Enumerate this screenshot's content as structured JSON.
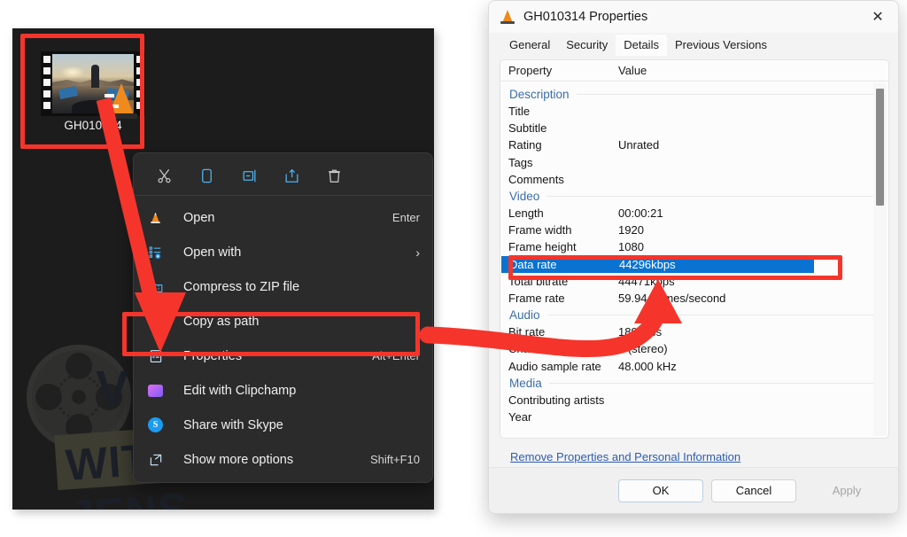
{
  "desktop": {
    "file": {
      "name": "GH010314",
      "icon": "video-file-thumbnail",
      "overlay_icon": "vlc-cone-icon"
    },
    "watermark": {
      "line1": "VIDEO",
      "line2": "WITH JENS",
      "logo": "film-reel-icon"
    },
    "background_color": "#1c1c1c"
  },
  "context_menu": {
    "toolbar": [
      {
        "name": "cut-icon",
        "label": "Cut"
      },
      {
        "name": "copy-icon",
        "label": "Copy"
      },
      {
        "name": "rename-icon",
        "label": "Rename"
      },
      {
        "name": "share-icon",
        "label": "Share"
      },
      {
        "name": "delete-icon",
        "label": "Delete"
      }
    ],
    "items": [
      {
        "label": "Open",
        "accel": "Enter",
        "icon": "vlc-cone-icon",
        "chevron": ""
      },
      {
        "label": "Open with",
        "accel": "",
        "icon": "open-with-icon",
        "chevron": "›"
      },
      {
        "label": "Compress to ZIP file",
        "accel": "",
        "icon": "zip-folder-icon",
        "chevron": ""
      },
      {
        "label": "Copy as path",
        "accel": "",
        "icon": "copy-as-path-icon",
        "chevron": ""
      },
      {
        "label": "Properties",
        "accel": "Alt+Enter",
        "icon": "properties-icon",
        "chevron": ""
      },
      {
        "label": "Edit with Clipchamp",
        "accel": "",
        "icon": "clipchamp-icon",
        "chevron": ""
      },
      {
        "label": "Share with Skype",
        "accel": "",
        "icon": "skype-icon",
        "chevron": ""
      },
      {
        "label": "Show more options",
        "accel": "Shift+F10",
        "icon": "show-more-options-icon",
        "chevron": ""
      }
    ]
  },
  "dialog": {
    "title": "GH010314 Properties",
    "title_icon": "vlc-cone-icon",
    "close_icon": "close-icon",
    "tabs": [
      {
        "label": "General",
        "active": false
      },
      {
        "label": "Security",
        "active": false
      },
      {
        "label": "Details",
        "active": true
      },
      {
        "label": "Previous Versions",
        "active": false
      }
    ],
    "columns": {
      "property": "Property",
      "value": "Value"
    },
    "groups": [
      {
        "name": "Description",
        "rows": [
          {
            "key": "Title",
            "value": ""
          },
          {
            "key": "Subtitle",
            "value": ""
          },
          {
            "key": "Rating",
            "value": "Unrated"
          },
          {
            "key": "Tags",
            "value": ""
          },
          {
            "key": "Comments",
            "value": ""
          }
        ]
      },
      {
        "name": "Video",
        "rows": [
          {
            "key": "Length",
            "value": "00:00:21"
          },
          {
            "key": "Frame width",
            "value": "1920"
          },
          {
            "key": "Frame height",
            "value": "1080"
          },
          {
            "key": "Data rate",
            "value": "44296kbps",
            "selected": true
          },
          {
            "key": "Total bitrate",
            "value": "44471kbps"
          },
          {
            "key": "Frame rate",
            "value": "59.94 frames/second"
          }
        ]
      },
      {
        "name": "Audio",
        "rows": [
          {
            "key": "Bit rate",
            "value": "189kbps"
          },
          {
            "key": "Channels",
            "value": "2 (stereo)"
          },
          {
            "key": "Audio sample rate",
            "value": "48.000 kHz"
          }
        ]
      },
      {
        "name": "Media",
        "rows": [
          {
            "key": "Contributing artists",
            "value": ""
          },
          {
            "key": "Year",
            "value": ""
          }
        ]
      }
    ],
    "remove_link": "Remove Properties and Personal Information",
    "buttons": {
      "ok": "OK",
      "cancel": "Cancel",
      "apply": "Apply"
    },
    "selection_color": "#0a72d0"
  },
  "annotations": {
    "highlight_color": "#f5352b",
    "boxes": [
      {
        "name": "file-icon-highlight"
      },
      {
        "name": "properties-menu-item-highlight"
      },
      {
        "name": "data-rate-row-highlight"
      }
    ],
    "arrows": [
      {
        "name": "arrow-file-to-properties",
        "kind": "straight"
      },
      {
        "name": "arrow-properties-to-data-rate",
        "kind": "curved"
      }
    ]
  }
}
